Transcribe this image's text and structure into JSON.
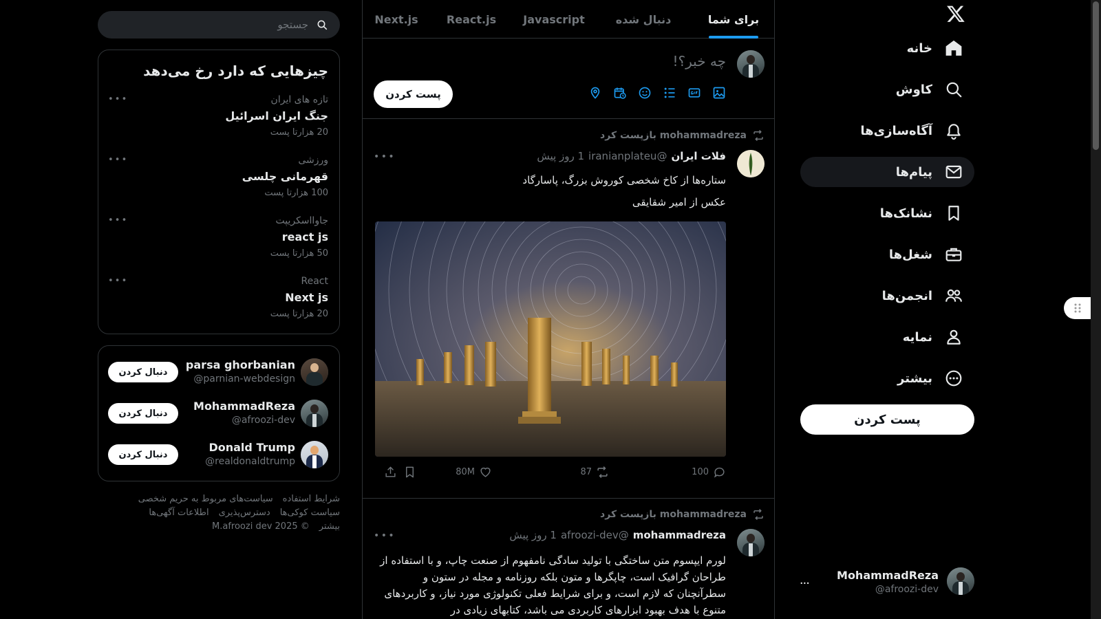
{
  "nav": {
    "logo": "x-logo-icon",
    "items": [
      {
        "label": "خانه",
        "icon": "home-icon"
      },
      {
        "label": "کاوش",
        "icon": "search-icon"
      },
      {
        "label": "آگاه‌سازی‌ها",
        "icon": "bell-icon"
      },
      {
        "label": "پیام‌ها",
        "icon": "mail-icon",
        "active": true
      },
      {
        "label": "نشانک‌ها",
        "icon": "bookmark-icon"
      },
      {
        "label": "شغل‌ها",
        "icon": "briefcase-icon"
      },
      {
        "label": "انجمن‌ها",
        "icon": "communities-icon"
      },
      {
        "label": "نمایه",
        "icon": "profile-icon"
      },
      {
        "label": "بیشتر",
        "icon": "more-circle-icon"
      }
    ],
    "post_button": "پست کردن",
    "account": {
      "name": "MohammadReza",
      "handle": "@afroozi-dev",
      "more": "..."
    }
  },
  "tabs": [
    {
      "label": "برای شما",
      "active": true
    },
    {
      "label": "دنبال شده"
    },
    {
      "label": "Javascript"
    },
    {
      "label": "React.js"
    },
    {
      "label": "Next.js"
    }
  ],
  "composer": {
    "placeholder": "چه خبر؟!",
    "tools": [
      "image-icon",
      "gif-icon",
      "poll-icon",
      "emoji-icon",
      "schedule-icon",
      "location-icon"
    ],
    "post_button": "پست کردن"
  },
  "posts": [
    {
      "retweet_text": "mohammadreza بازپست کرد",
      "name": "فلات ایران",
      "handle": "@iranianplateu",
      "time": "1 روز پیش",
      "lines": [
        "ستاره‌ها از کاخ شخصی کوروش بزرگ، پاسارگاد",
        "عکس از امیر شقایقی"
      ],
      "actions": {
        "replies": "100",
        "retweets": "87",
        "likes": "80M"
      }
    },
    {
      "retweet_text": "mohammadreza بازپست کرد",
      "name": "mohammadreza",
      "handle": "@afroozi-dev",
      "time": "1 روز پیش",
      "text": "لورم ایپسوم متن ساختگی با تولید سادگی نامفهوم از صنعت چاپ، و با استفاده از طراحان گرافیک است، چاپگرها و متون بلکه روزنامه و مجله در ستون و سطرآنچنان که لازم است، و برای شرایط فعلی تکنولوژی مورد نیاز، و کاربردهای متنوع با هدف بهبود ابزارهای کاربردی می باشد، کتابهای زیادی در"
    }
  ],
  "search": {
    "placeholder": "جستجو"
  },
  "trends": {
    "title": "چیزهایی که دارد رخ می‌دهد",
    "items": [
      {
        "category": "تازه های ایران",
        "name": "جنگ ایران اسرائیل",
        "count": "20 هزارتا پست"
      },
      {
        "category": "ورزشی",
        "name": "قهرمانی چلسی",
        "count": "100 هزارتا پست"
      },
      {
        "category": "جاوااسکریپت",
        "name": "react js",
        "count": "50 هزارتا پست"
      },
      {
        "category": "React",
        "name": "Next js",
        "count": "20 هزارتا پست"
      }
    ],
    "more": "..."
  },
  "who_to_follow": [
    {
      "name": "parsa ghorbanian",
      "handle": "@parnian-webdesign",
      "button": "دنبال کردن"
    },
    {
      "name": "MohammadReza",
      "handle": "@afroozi-dev",
      "button": "دنبال کردن"
    },
    {
      "name": "Donald Trump",
      "handle": "@realdonaldtrump",
      "button": "دنبال کردن"
    }
  ],
  "footer": {
    "row1": [
      "شرایط استفاده",
      "سیاست‌های مربوط به حریم شخصی"
    ],
    "row2": [
      "سیاست کوکی‌ها",
      "دسترس‌پذیری",
      "اطلاعات آگهی‌ها"
    ],
    "row3": [
      "بیشتر",
      "© 2025 M.afroozi dev"
    ]
  },
  "colors": {
    "accent": "#1d9bf0",
    "background": "#000000",
    "border": "#2f3336",
    "muted": "#71767b"
  }
}
